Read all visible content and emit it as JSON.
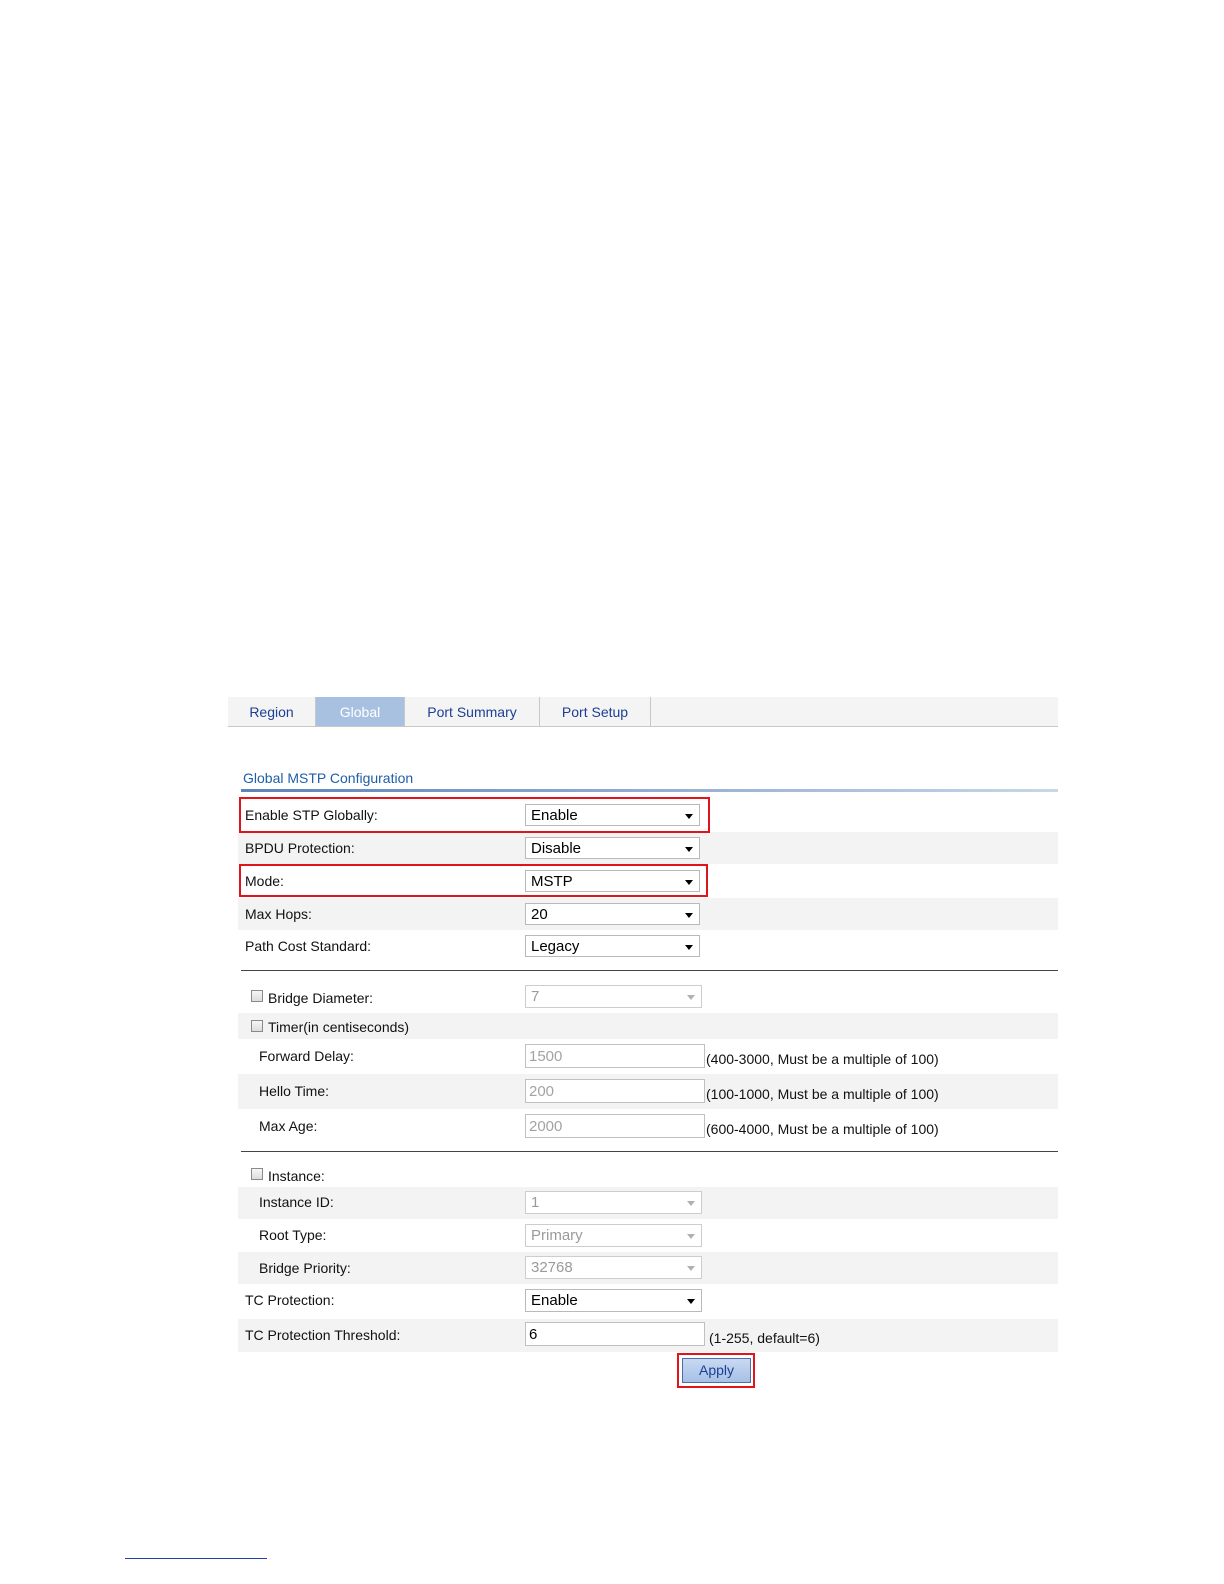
{
  "tabs": [
    {
      "label": "Region",
      "active": false
    },
    {
      "label": "Global",
      "active": true
    },
    {
      "label": "Port Summary",
      "active": false
    },
    {
      "label": "Port Setup",
      "active": false
    }
  ],
  "section_title": "Global MSTP Configuration",
  "fields": {
    "enable_stp": {
      "label": "Enable STP Globally:",
      "value": "Enable"
    },
    "bpdu_protection": {
      "label": "BPDU Protection:",
      "value": "Disable"
    },
    "mode": {
      "label": "Mode:",
      "value": "MSTP"
    },
    "max_hops": {
      "label": "Max Hops:",
      "value": "20"
    },
    "path_cost": {
      "label": "Path Cost Standard:",
      "value": "Legacy"
    },
    "bridge_diameter": {
      "label": "Bridge Diameter:",
      "value": "7",
      "checked": false
    },
    "timer": {
      "label": "Timer(in centiseconds)",
      "checked": false
    },
    "forward_delay": {
      "label": "Forward Delay:",
      "value": "1500",
      "hint": "(400-3000, Must be a multiple of 100)"
    },
    "hello_time": {
      "label": "Hello Time:",
      "value": "200",
      "hint": "(100-1000, Must be a multiple of 100)"
    },
    "max_age": {
      "label": "Max Age:",
      "value": "2000",
      "hint": "(600-4000, Must be a multiple of 100)"
    },
    "instance": {
      "label": "Instance:",
      "checked": false
    },
    "instance_id": {
      "label": "Instance ID:",
      "value": "1"
    },
    "root_type": {
      "label": "Root Type:",
      "value": "Primary"
    },
    "bridge_priority": {
      "label": "Bridge Priority:",
      "value": "32768"
    },
    "tc_protection": {
      "label": "TC Protection:",
      "value": "Enable"
    },
    "tc_threshold": {
      "label": "TC Protection Threshold:",
      "value": "6",
      "hint": "(1-255, default=6)"
    }
  },
  "apply_label": "Apply",
  "colors": {
    "highlight": "#e0151b",
    "tab_active": "#a9c1e1",
    "link": "#1c3f94"
  }
}
